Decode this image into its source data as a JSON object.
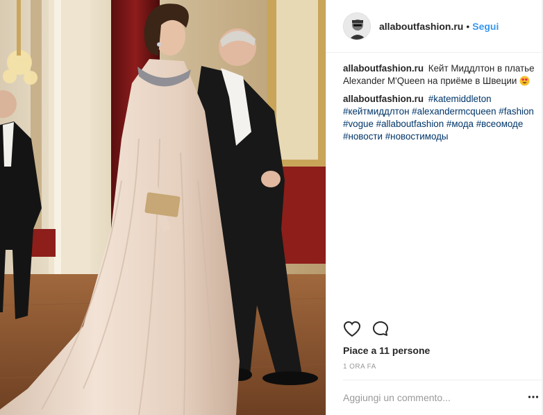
{
  "post": {
    "username": "allaboutfashion.ru",
    "separator": "•",
    "follow_label": "Segui",
    "caption": {
      "username": "allaboutfashion.ru",
      "text": "Кейт Миддлтон в платье Alexander M'Queen на приёме в Швеции",
      "emoji": "heart-eyes-emoji"
    },
    "hashtag_comment": {
      "username": "allaboutfashion.ru",
      "tags": "#katemiddleton #кейтмиддлтон #alexandermcqueen #fashion #vogue #allaboutfashion #мода #всеомоде #новости #новостимоды"
    },
    "likes": "Piace a 11 persone",
    "timestamp": "1 ORA FA",
    "comment_placeholder": "Aggiungi un commento...",
    "icons": {
      "like": "heart-outline-icon",
      "comment": "speech-bubble-icon",
      "more": "more-options-icon"
    }
  },
  "colors": {
    "link": "#3897f0",
    "hashtag": "#003569",
    "muted": "#999999",
    "text": "#262626",
    "divider": "#efefef"
  }
}
